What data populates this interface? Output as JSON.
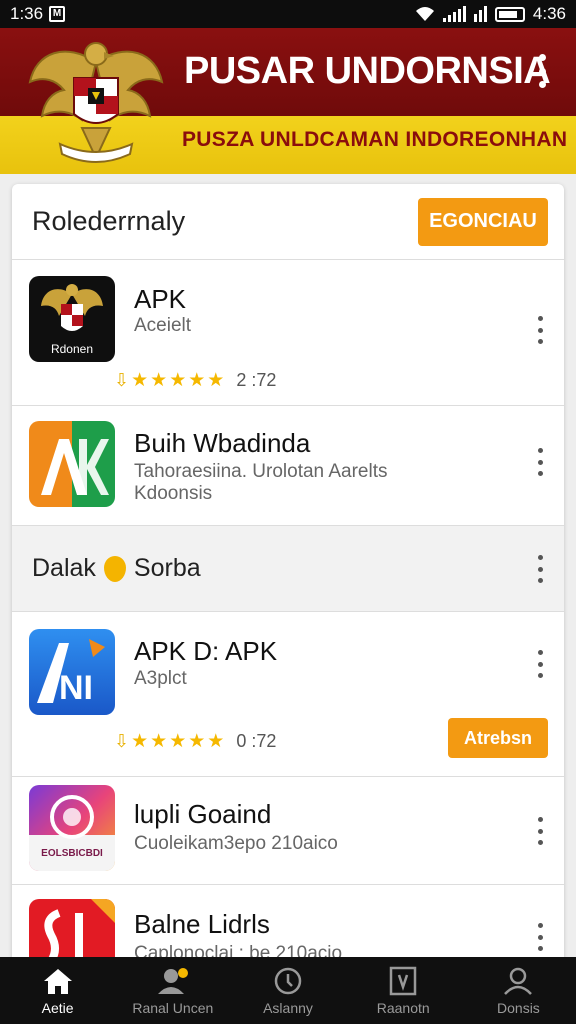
{
  "status": {
    "time_left": "1:36",
    "time_right": "4:36"
  },
  "header": {
    "title": "PUSAR UNDORNSIA",
    "subtitle": "PUSZA UNLDCAMAN INDOREONHAN"
  },
  "section_header": {
    "title": "Rolederrnaly",
    "button": "EGONCIAU"
  },
  "apps": [
    {
      "title": "APK",
      "desc": "Aceielt",
      "icon_label": "Rdonen",
      "rating": "2 :72"
    },
    {
      "title": "Buih Wbadinda",
      "desc_line1": "Tahoraesiina. Urolotan Aarelts",
      "desc_line2": "Kdoonsis"
    },
    {
      "title": "APK D: APK",
      "desc": "A3plct",
      "rating": "0 :72",
      "action": "Atrebsn"
    },
    {
      "title": "lupli Goaind",
      "desc": "Cuoleikam3epo 210aico",
      "icon_label": "EOLSBICBDI"
    },
    {
      "title": "Balne Lidrls",
      "desc": "Caplonoclai : be 210acio"
    }
  ],
  "divider_section": {
    "label_part1": "Dalak",
    "label_part2": "Sorba"
  },
  "nav": [
    {
      "label": "Aetie",
      "icon": "home-icon"
    },
    {
      "label": "Ranal Uncen",
      "icon": "profile-icon"
    },
    {
      "label": "Aslanny",
      "icon": "clock-icon"
    },
    {
      "label": "Raanotn",
      "icon": "news-icon"
    },
    {
      "label": "Donsis",
      "icon": "user-icon"
    }
  ],
  "colors": {
    "header_red": "#7d0d0d",
    "header_yellow": "#f2d21c",
    "accent_orange": "#f39a12",
    "star": "#f5b800"
  }
}
